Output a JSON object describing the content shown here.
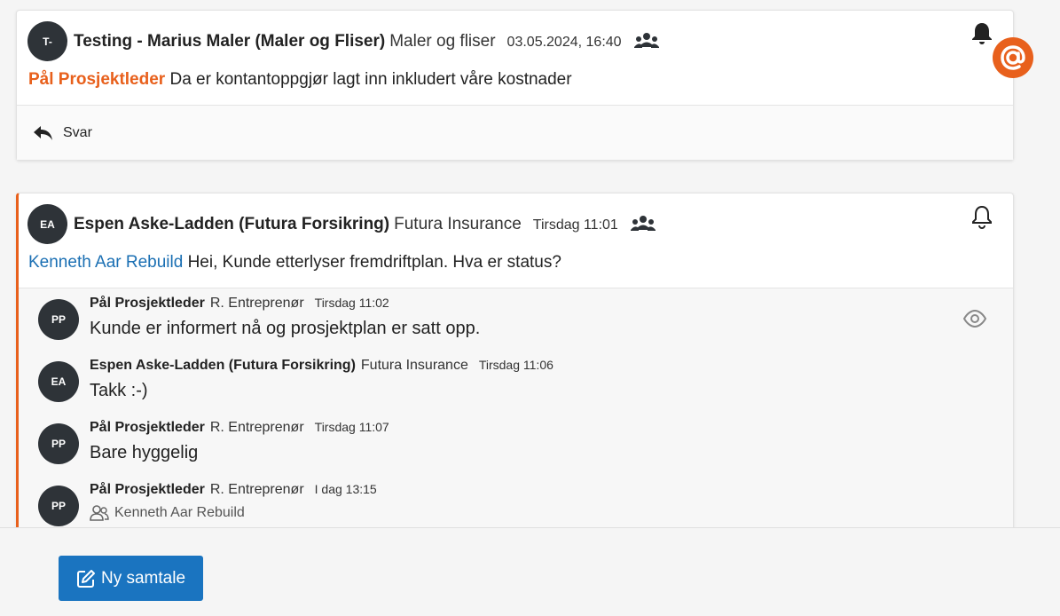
{
  "thread1": {
    "avatar": "T-",
    "author": "Testing - Marius Maler (Maler og Fliser)",
    "company": "Maler og fliser",
    "timestamp": "03.05.2024, 16:40",
    "mention": "Pål Prosjektleder",
    "message": "Da er kontantoppgjør lagt inn inkludert våre kostnader",
    "reply_label": "Svar",
    "icons": {
      "group": "group-icon",
      "bell": "bell-filled-icon",
      "mention": "at-sign-icon",
      "reply": "reply-arrow-icon"
    }
  },
  "thread2": {
    "avatar": "EA",
    "author": "Espen Aske-Ladden (Futura Forsikring)",
    "company": "Futura Insurance",
    "timestamp": "Tirsdag 11:01",
    "mention": "Kenneth Aar Rebuild",
    "message": "Hei, Kunde etterlyser fremdriftplan. Hva er status?",
    "icons": {
      "group": "group-icon",
      "bell": "bell-outline-icon"
    },
    "replies": [
      {
        "avatar": "PP",
        "author": "Pål Prosjektleder",
        "company": "R. Entreprenør",
        "time": "Tirsdag 11:02",
        "text": "Kunde er informert nå og prosjektplan er satt opp."
      },
      {
        "avatar": "EA",
        "author": "Espen Aske-Ladden (Futura Forsikring)",
        "company": "Futura Insurance",
        "time": "Tirsdag 11:06",
        "text": "Takk :-)"
      },
      {
        "avatar": "PP",
        "author": "Pål Prosjektleder",
        "company": "R. Entreprenør",
        "time": "Tirsdag 11:07",
        "text": "Bare hyggelig"
      },
      {
        "avatar": "PP",
        "author": "Pål Prosjektleder",
        "company": "R. Entreprenør",
        "time": "I dag 13:15",
        "recipient": "Kenneth Aar Rebuild"
      }
    ]
  },
  "footer": {
    "new_conversation_label": "Ny samtale",
    "icon": "edit-icon"
  },
  "colors": {
    "accent_orange": "#e8601c",
    "link_blue": "#1a6fb3",
    "button_blue": "#1a74c0",
    "avatar_dark": "#2e3338"
  }
}
